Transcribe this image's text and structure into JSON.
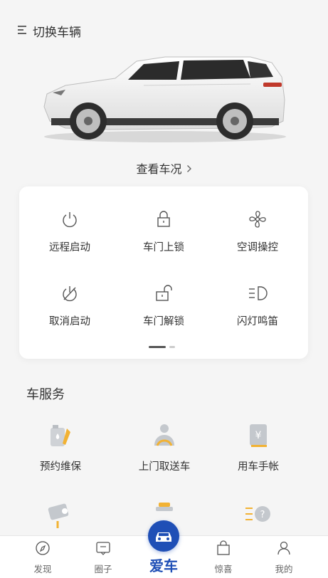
{
  "header": {
    "switch_vehicle_label": "切换车辆"
  },
  "hero": {
    "view_status_label": "查看车况"
  },
  "controls": [
    {
      "label": "远程启动",
      "icon": "power-icon"
    },
    {
      "label": "车门上锁",
      "icon": "lock-icon"
    },
    {
      "label": "空调操控",
      "icon": "fan-icon"
    },
    {
      "label": "取消启动",
      "icon": "power-off-icon"
    },
    {
      "label": "车门解锁",
      "icon": "unlock-icon"
    },
    {
      "label": "闪灯鸣笛",
      "icon": "headlight-icon"
    }
  ],
  "services": {
    "title": "车服务",
    "items": [
      {
        "label": "预约维保",
        "icon": "oil-maintenance-icon"
      },
      {
        "label": "上门取送车",
        "icon": "pickup-delivery-icon"
      },
      {
        "label": "用车手帐",
        "icon": "car-ledger-icon"
      }
    ]
  },
  "bottom_nav": {
    "items": [
      {
        "label": "发现",
        "icon": "compass-icon"
      },
      {
        "label": "圈子",
        "icon": "message-icon"
      },
      {
        "label": "爱车",
        "icon": "car-icon",
        "active": true
      },
      {
        "label": "惊喜",
        "icon": "bag-icon"
      },
      {
        "label": "我的",
        "icon": "user-icon"
      }
    ]
  },
  "colors": {
    "accent": "#1f4fb6",
    "background": "#f5f5f5",
    "card": "#ffffff"
  }
}
